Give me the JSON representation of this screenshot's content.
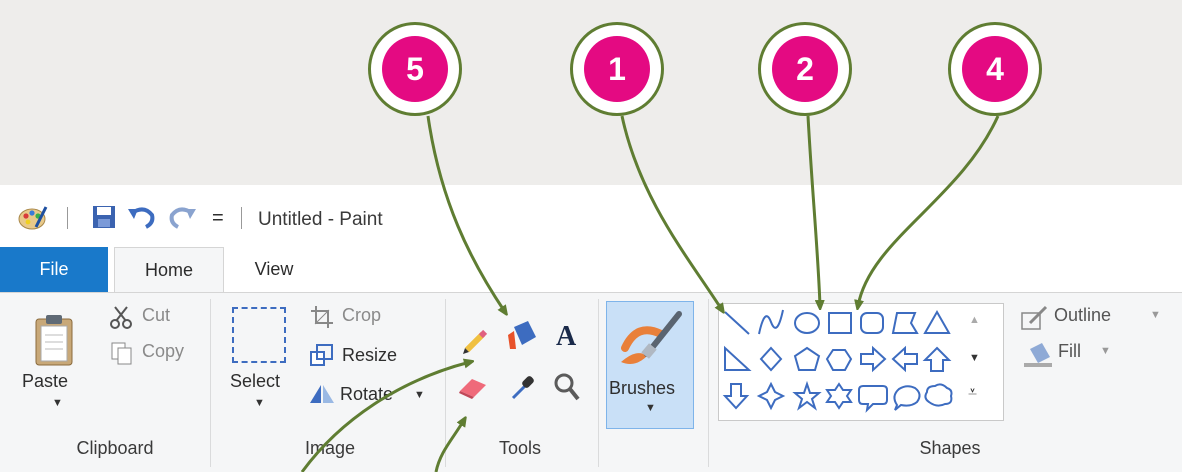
{
  "callouts": [
    "5",
    "1",
    "2",
    "4"
  ],
  "window": {
    "title": "Untitled - Paint",
    "qat_dropdown": "="
  },
  "tabs": {
    "file": "File",
    "home": "Home",
    "view": "View"
  },
  "clipboard": {
    "paste": "Paste",
    "cut": "Cut",
    "copy": "Copy",
    "group_label": "Clipboard"
  },
  "image": {
    "select": "Select",
    "crop": "Crop",
    "resize": "Resize",
    "rotate": "Rotate",
    "group_label": "Image"
  },
  "tools": {
    "group_label": "Tools",
    "items": [
      "pencil-icon",
      "fill-bucket-icon",
      "text-icon",
      "eraser-icon",
      "color-picker-icon",
      "magnifier-icon"
    ]
  },
  "brushes": {
    "label": "Brushes"
  },
  "shapes": {
    "group_label": "Shapes",
    "outline": "Outline",
    "fill": "Fill",
    "items": [
      "line",
      "curve",
      "oval",
      "rectangle",
      "rounded-rectangle",
      "polygon",
      "triangle",
      "right-triangle",
      "diamond",
      "pentagon",
      "hexagon",
      "right-arrow",
      "left-arrow",
      "up-arrow",
      "down-arrow",
      "four-point-star",
      "five-point-star",
      "six-point-star",
      "rounded-callout",
      "oval-callout",
      "cloud-callout"
    ]
  },
  "colors": {
    "accent": "#1979ca",
    "callout_fill": "#e40a82",
    "arrow": "#5f7d32"
  }
}
